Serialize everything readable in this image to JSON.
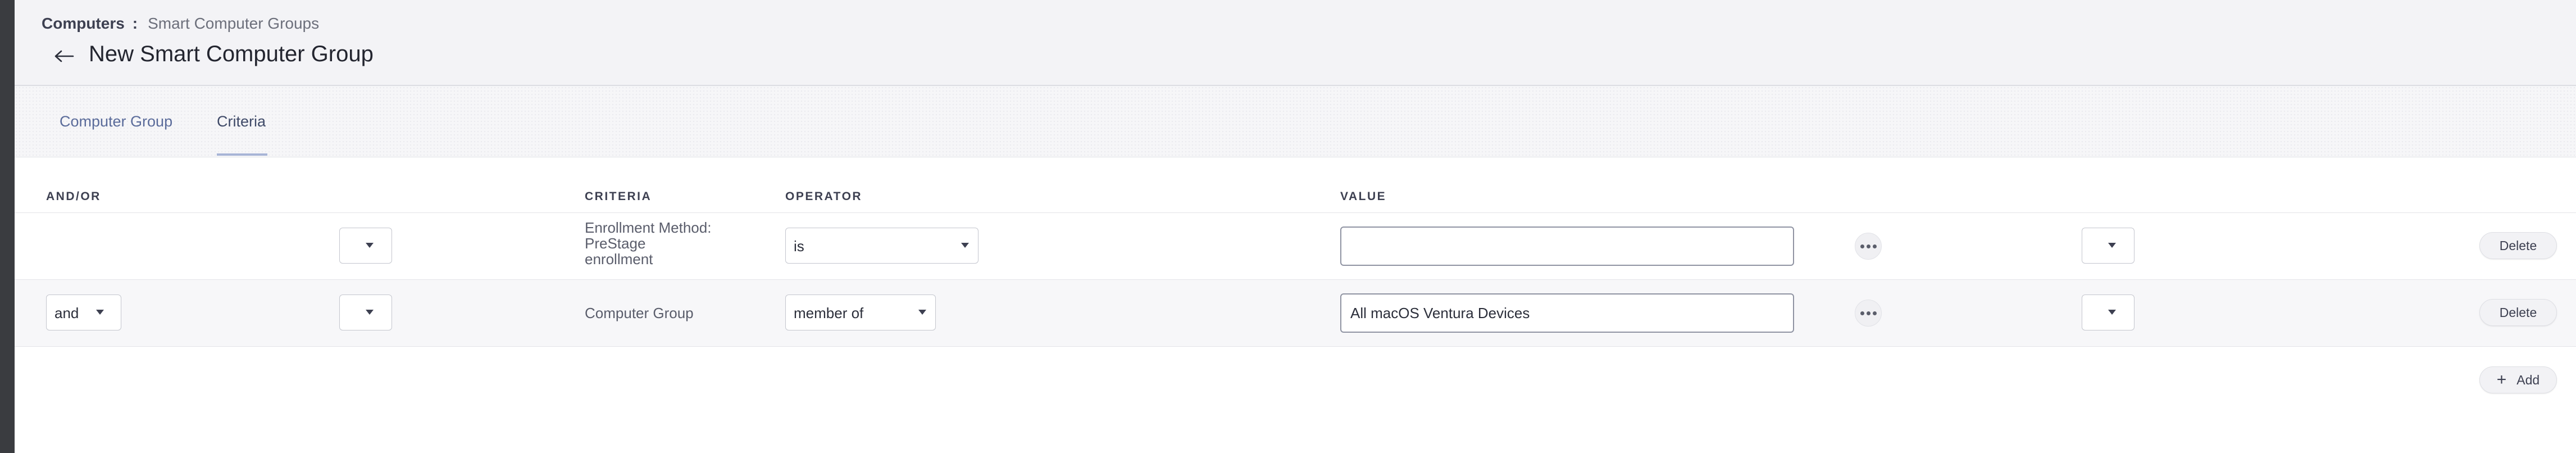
{
  "breadcrumb": {
    "section": "Computers",
    "separator": ":",
    "page": "Smart Computer Groups"
  },
  "page_title": "New Smart Computer Group",
  "tabs": [
    {
      "label": "Computer Group",
      "active": false
    },
    {
      "label": "Criteria",
      "active": true
    }
  ],
  "columns": {
    "and_or": "AND/OR",
    "criteria": "CRITERIA",
    "operator": "OPERATOR",
    "value": "VALUE"
  },
  "rows": [
    {
      "and_or": "",
      "criteria_lines": [
        "Enrollment Method:",
        "PreStage",
        "enrollment"
      ],
      "operator": "is",
      "value": "",
      "delete_label": "Delete"
    },
    {
      "and_or": "and",
      "criteria": "Computer Group",
      "operator": "member of",
      "value": "All macOS Ventura Devices",
      "delete_label": "Delete"
    }
  ],
  "add_label": "Add",
  "icons": {
    "back": "arrow-left-icon",
    "more": "ellipsis-icon",
    "caret": "caret-down-icon",
    "add": "plus-icon"
  },
  "colors": {
    "accent": "#5a6b9a",
    "header_bg": "#f3f3f6",
    "sidebar": "#3a3c40"
  }
}
